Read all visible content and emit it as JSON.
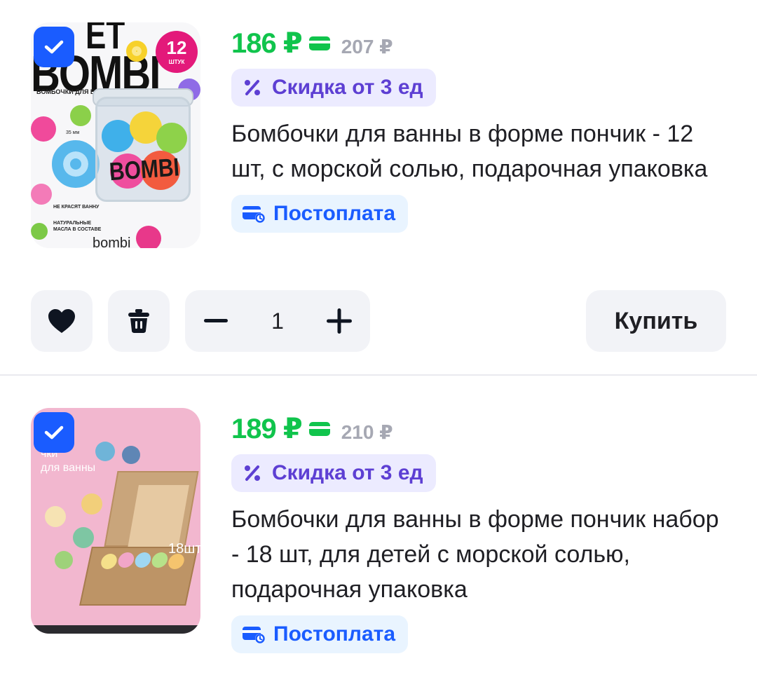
{
  "colors": {
    "price_green": "#10c44c",
    "old_price_gray": "#a6a8b3",
    "discount_bg": "#ecebff",
    "discount_text": "#5d3fd3",
    "postpay_bg": "#e9f4ff",
    "postpay_text": "#1a5cff",
    "checkbox_blue": "#1a5cff",
    "button_bg": "#f2f3f7"
  },
  "items": [
    {
      "selected": true,
      "price": "186 ₽",
      "old_price": "207 ₽",
      "discount_label": "Скидка от 3 ед",
      "title": "Бомбочки для ванны в форме пончик - 12 шт, с морской солью, подарочная упаковка",
      "payment_label": "Постоплата",
      "image_text": {
        "brand_top": "ET",
        "brand": "BOMBI",
        "subtitle": "БОМБОЧКИ ДЛЯ ВАННЫ",
        "count": "12",
        "count_unit": "ШТУК",
        "size": "35 мм",
        "jar_label": "BOMBI",
        "feature_1": "НЕ КРАСЯТ ВАННУ",
        "feature_2": "НАТУРАЛЬНЫЕ МАСЛА В СОСТАВЕ",
        "logo": "bombi"
      },
      "actions": {
        "quantity": "1",
        "buy_label": "Купить"
      }
    },
    {
      "selected": true,
      "price": "189 ₽",
      "old_price": "210 ₽",
      "discount_label": "Скидка от 3 ед",
      "title": "Бомбочки для ванны в форме пончик набор - 18 шт, для детей с морской солью, подарочная упаковка",
      "payment_label": "Постоплата",
      "image_text": {
        "caption": "чки\nдля ванны",
        "count": "18шт"
      }
    }
  ],
  "icons": {
    "check": "check-icon",
    "wallet": "wallet-icon",
    "percent": "percent-icon",
    "postpay": "card-clock-icon",
    "like": "heart-icon",
    "delete": "trash-icon",
    "minus": "minus-icon",
    "plus": "plus-icon"
  }
}
